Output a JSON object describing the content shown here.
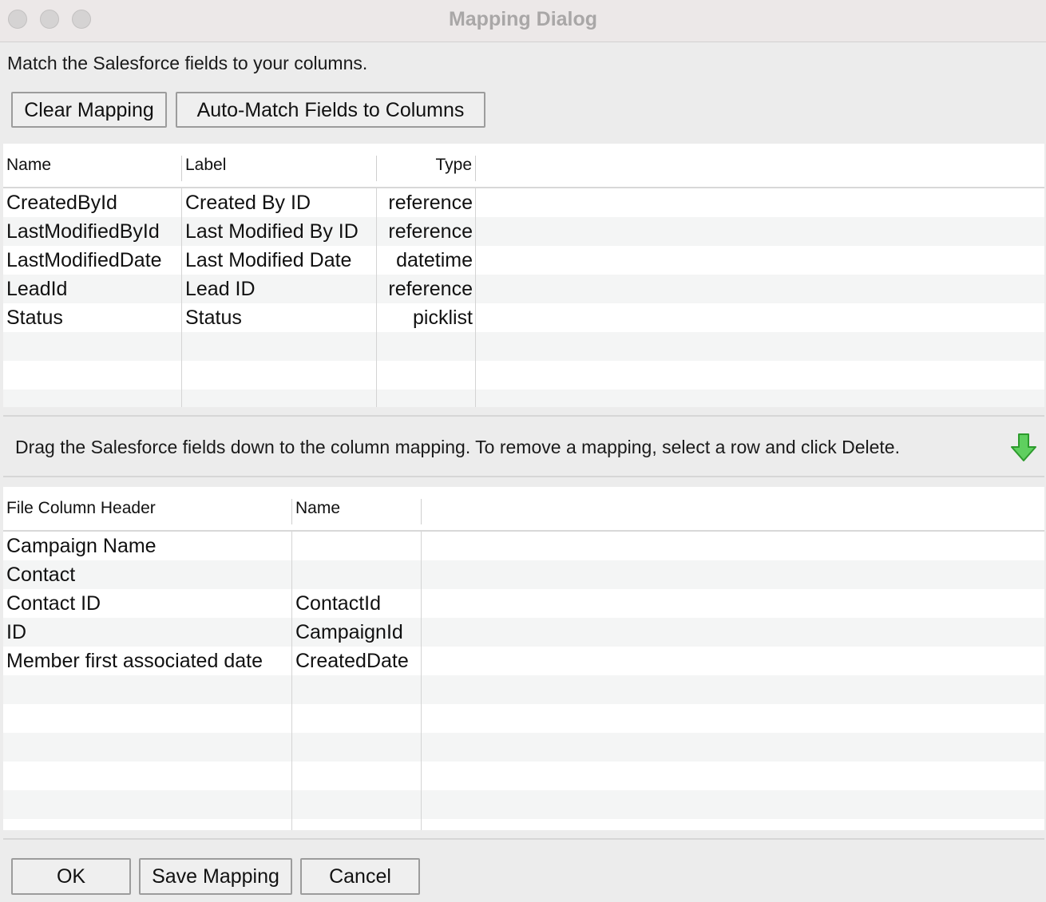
{
  "window": {
    "title": "Mapping Dialog"
  },
  "instructions": "Match the Salesforce fields to your columns.",
  "toolbar": {
    "clear_label": "Clear Mapping",
    "auto_match_label": "Auto-Match Fields to Columns"
  },
  "fields_table": {
    "headers": {
      "name": "Name",
      "label": "Label",
      "type": "Type"
    },
    "rows": [
      {
        "name": "CreatedById",
        "label": "Created By ID",
        "type": "reference"
      },
      {
        "name": "LastModifiedById",
        "label": "Last Modified By ID",
        "type": "reference"
      },
      {
        "name": "LastModifiedDate",
        "label": "Last Modified Date",
        "type": "datetime"
      },
      {
        "name": "LeadId",
        "label": "Lead ID",
        "type": "reference"
      },
      {
        "name": "Status",
        "label": "Status",
        "type": "picklist"
      }
    ]
  },
  "drag_instructions": "Drag the Salesforce fields down to the column mapping.  To remove a mapping, select a row and click Delete.",
  "drag_icon": "green-down-arrow-icon",
  "mapping_table": {
    "headers": {
      "column": "File Column Header",
      "name": "Name"
    },
    "rows": [
      {
        "column": "Campaign Name",
        "name": ""
      },
      {
        "column": "Contact",
        "name": ""
      },
      {
        "column": "Contact ID",
        "name": "ContactId"
      },
      {
        "column": "ID",
        "name": "CampaignId"
      },
      {
        "column": "Member first associated date",
        "name": "CreatedDate"
      }
    ]
  },
  "footer": {
    "ok_label": "OK",
    "save_label": "Save Mapping",
    "cancel_label": "Cancel"
  },
  "colors": {
    "accent_arrow": "#3db33d",
    "row_alt": "#f4f5f5"
  }
}
